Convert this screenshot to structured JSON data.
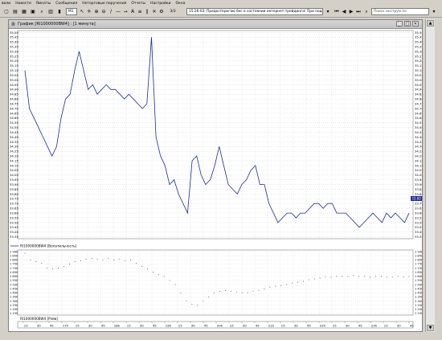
{
  "menu": [
    "вали",
    "Новости",
    "Ямнаты",
    "Сообщения",
    "Неторговые поручения",
    "Отчеты",
    "Настройки",
    "Окна"
  ],
  "toolbar": {
    "interval": "M1",
    "counter": "3/3",
    "message": "15:26:03: Предостерегаю бес в состоянии интернет-трейдинга!   При подаче пор",
    "search_placeholder": "Поиск инструм по"
  },
  "window": {
    "title": "График [RI1000000BW4] : [1 минута]"
  },
  "price_panel": {
    "axis_labels": [
      "35.50",
      "35.45",
      "35.40",
      "35.35",
      "35.30",
      "35.25",
      "35.20",
      "35.15",
      "35.10",
      "35.05",
      "35.00",
      "34.95",
      "34.90",
      "34.85",
      "34.80",
      "34.75",
      "34.70",
      "34.65",
      "34.60",
      "34.55",
      "34.50",
      "34.45",
      "34.40",
      "34.35",
      "34.30",
      "34.25",
      "34.20",
      "34.15",
      "34.10",
      "34.05",
      "34.00",
      "33.95",
      "33.90",
      "33.85",
      "33.80",
      "33.75",
      "33.70",
      "33.65",
      "33.60",
      "33.55",
      "33.50",
      "33.45",
      "33.40",
      "33.35"
    ],
    "current_value": "33.60",
    "legend": "RI1000000BW4 [Волатильность]"
  },
  "volume_panel": {
    "axis_labels": [
      "1 900",
      "1 850",
      "1 800",
      "1 750",
      "1 700",
      "1 650",
      "1 600",
      "1 550",
      "1 500",
      "1 450",
      "1 400",
      "1 350",
      "1 300",
      "1 250",
      "1 200",
      "1 150"
    ],
    "legend": "RI1000000BW4 [Рэйв]"
  },
  "time_axis": [
    "15",
    "30",
    "45",
    "17h",
    "15",
    "30",
    "45",
    "18h",
    "15",
    "30",
    "45",
    "19h",
    "15",
    "30",
    "45",
    "20h",
    "15",
    "30",
    "45",
    "21h",
    "15",
    "30",
    "45",
    "22h",
    "15",
    "30",
    "45",
    "23h",
    "15",
    "30",
    "45"
  ],
  "chart_data": [
    {
      "type": "line",
      "series": [
        {
          "values": [
            35.1,
            34.7,
            34.6,
            34.5,
            34.4,
            34.3,
            34.2,
            34.3,
            34.6,
            34.8,
            34.85,
            35.1,
            35.3,
            35.1,
            34.9,
            34.95,
            34.85,
            34.9,
            34.95,
            34.9,
            34.9,
            34.85,
            34.8,
            34.85,
            34.8,
            34.75,
            34.7,
            34.75,
            35.45,
            34.4,
            34.2,
            34.1,
            33.9,
            33.95,
            33.8,
            33.7,
            33.6,
            34.15,
            34.2,
            34.0,
            33.9,
            33.95,
            34.1,
            34.3,
            34.1,
            33.9,
            33.85,
            33.8,
            33.9,
            33.95,
            34.05,
            34.1,
            33.9,
            33.9,
            33.7,
            33.6,
            33.5,
            33.55,
            33.6,
            33.6,
            33.55,
            33.6,
            33.6,
            33.65,
            33.7,
            33.7,
            33.65,
            33.7,
            33.7,
            33.6,
            33.6,
            33.6,
            33.55,
            33.5,
            33.45,
            33.5,
            33.55,
            33.6,
            33.55,
            33.5,
            33.6,
            33.55,
            33.6,
            33.55,
            33.5,
            33.6
          ]
        }
      ],
      "ylim": [
        33.33,
        35.52
      ],
      "grid": true
    },
    {
      "type": "scatter",
      "series": [
        {
          "values": [
            1880,
            1800,
            1780,
            1760,
            1700,
            1690,
            1700,
            1720,
            1750,
            1780,
            1790,
            1810,
            1820,
            1810,
            1800,
            1820,
            1800,
            1810,
            1790,
            1800,
            1760,
            1720,
            1690,
            1650,
            1620,
            1600,
            1550,
            1500,
            1400,
            1300,
            1260,
            1250,
            1300,
            1350,
            1400,
            1420,
            1430,
            1420,
            1410,
            1400,
            1400,
            1420,
            1430,
            1450,
            1470,
            1480,
            1490,
            1500,
            1520,
            1530,
            1540,
            1560,
            1570,
            1580,
            1590,
            1590,
            1600,
            1600,
            1600,
            1610,
            1600,
            1600,
            1590,
            1600,
            1600,
            1590,
            1590,
            1600,
            1590,
            1600
          ]
        }
      ],
      "ylim": [
        1130,
        1920
      ],
      "grid": true
    }
  ]
}
